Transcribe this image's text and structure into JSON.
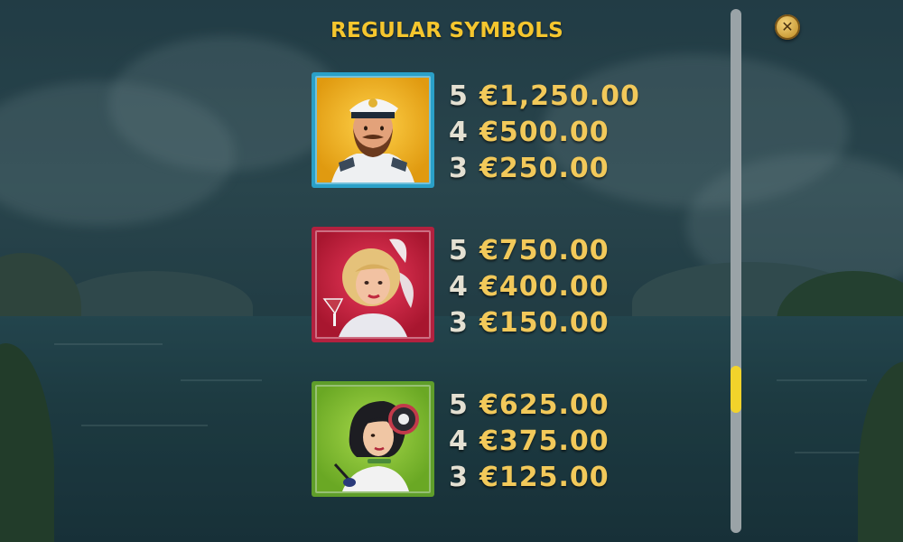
{
  "title": "REGULAR SYMBOLS",
  "close_icon": "close-icon",
  "symbols": [
    {
      "name": "captain",
      "frame_color": "#2aa0c8",
      "bg_color": "#f2b617",
      "pays": [
        {
          "count": "5",
          "amount": "€1,250.00"
        },
        {
          "count": "4",
          "amount": "€500.00"
        },
        {
          "count": "3",
          "amount": "€250.00"
        }
      ]
    },
    {
      "name": "blonde-lady",
      "frame_color": "#b3213f",
      "bg_color": "#d8244a",
      "pays": [
        {
          "count": "5",
          "amount": "€750.00"
        },
        {
          "count": "4",
          "amount": "€400.00"
        },
        {
          "count": "3",
          "amount": "€150.00"
        }
      ]
    },
    {
      "name": "flapper-lady",
      "frame_color": "#5f9e2a",
      "bg_color": "#8cc63a",
      "pays": [
        {
          "count": "5",
          "amount": "€625.00"
        },
        {
          "count": "4",
          "amount": "€375.00"
        },
        {
          "count": "3",
          "amount": "€125.00"
        }
      ]
    }
  ],
  "colors": {
    "title": "#f5c62e",
    "amount": "#f2c95a",
    "scroll_thumb": "#f2d32b"
  }
}
